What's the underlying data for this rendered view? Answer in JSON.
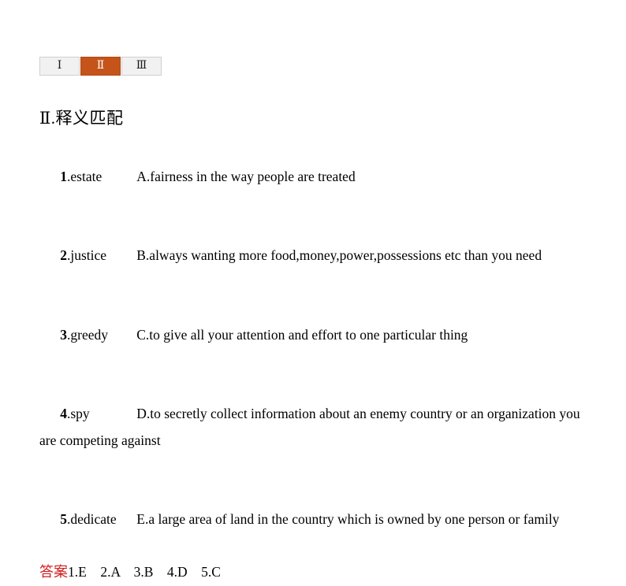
{
  "tabs": [
    {
      "label": "Ⅰ",
      "active": false
    },
    {
      "label": "Ⅱ",
      "active": true
    },
    {
      "label": "Ⅲ",
      "active": false
    }
  ],
  "heading": "Ⅱ.释义匹配",
  "items": [
    {
      "num": "1",
      "dot": ".",
      "term": "estate",
      "defn": "A.fairness in the way people are treated"
    },
    {
      "num": "2",
      "dot": ".",
      "term": "justice",
      "defn": "B.always wanting more food,money,power,possessions etc than you need"
    },
    {
      "num": "3",
      "dot": ".",
      "term": "greedy",
      "defn": "C.to give all your attention and effort to one particular thing"
    },
    {
      "num": "4",
      "dot": ".",
      "term": "spy",
      "defn": "D.to secretly collect information about an enemy country or an organization you are competing against"
    },
    {
      "num": "5",
      "dot": ".",
      "term": "dedicate",
      "defn": "E.a large area of land in the country which is owned by one person or family"
    }
  ],
  "answer": {
    "label": "答案",
    "values": "1.E　2.A　3.B　4.D　5.C"
  },
  "colors": {
    "tab_active_bg": "#c4541a",
    "tab_inactive_bg": "#f1f1f1",
    "tab_border": "#cfcfcf",
    "answer_label": "#d01b1b",
    "text": "#000000",
    "page_bg": "#ffffff"
  }
}
